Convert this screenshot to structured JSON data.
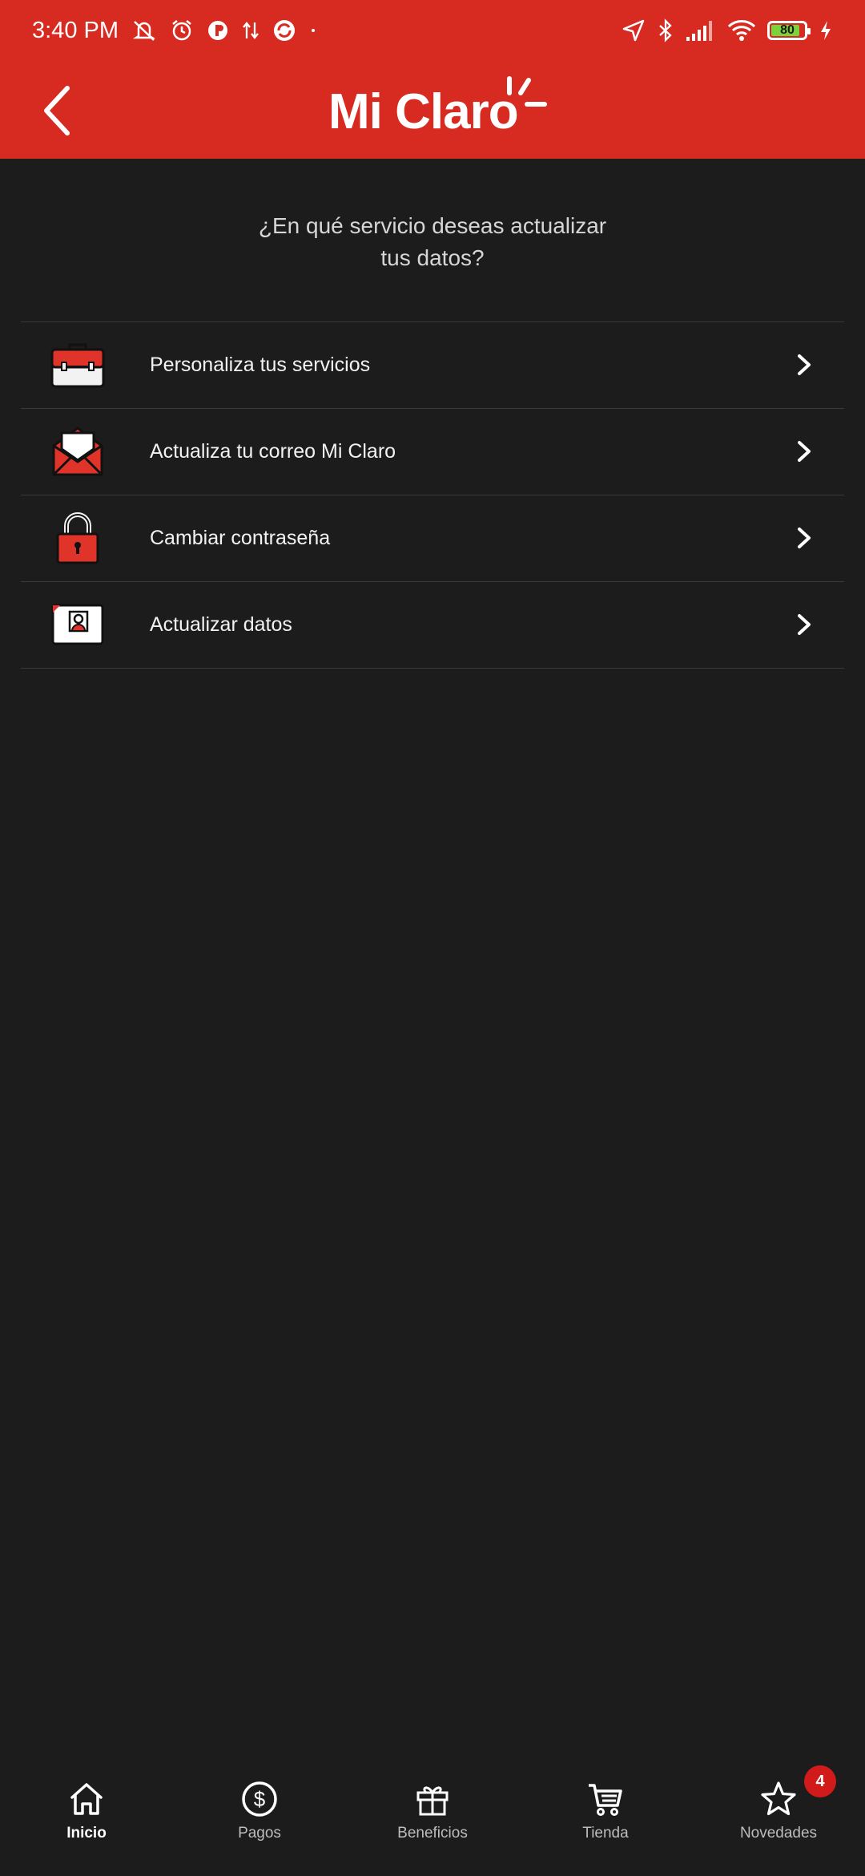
{
  "status_bar": {
    "time": "3:40 PM",
    "battery": "80",
    "icons": [
      "mute-icon",
      "alarm-icon",
      "app-icon",
      "data-arrows-icon",
      "sync-icon",
      "location-icon",
      "bluetooth-icon",
      "signal-icon",
      "wifi-icon",
      "battery-icon",
      "charging-icon"
    ]
  },
  "header": {
    "logo_text": "Mi Claro",
    "back_icon": "chevron-left-icon",
    "background_color": "#d72a20"
  },
  "question": {
    "line1": "¿En qué servicio deseas actualizar",
    "line2": "tus datos?"
  },
  "menu": {
    "items": [
      {
        "label": "Personaliza tus servicios",
        "icon": "briefcase-icon"
      },
      {
        "label": "Actualiza tu correo Mi Claro",
        "icon": "envelope-icon"
      },
      {
        "label": "Cambiar contraseña",
        "icon": "padlock-icon"
      },
      {
        "label": "Actualizar datos",
        "icon": "id-card-icon"
      }
    ]
  },
  "bottom_nav": {
    "items": [
      {
        "label": "Inicio",
        "icon": "home-icon",
        "active": true
      },
      {
        "label": "Pagos",
        "icon": "dollar-icon",
        "active": false
      },
      {
        "label": "Beneficios",
        "icon": "gift-icon",
        "active": false
      },
      {
        "label": "Tienda",
        "icon": "cart-icon",
        "active": false
      },
      {
        "label": "Novedades",
        "icon": "star-icon",
        "active": false,
        "badge": "4"
      }
    ]
  },
  "colors": {
    "accent": "#d72a20",
    "background": "#1c1c1c",
    "badge": "#d11a1a"
  }
}
